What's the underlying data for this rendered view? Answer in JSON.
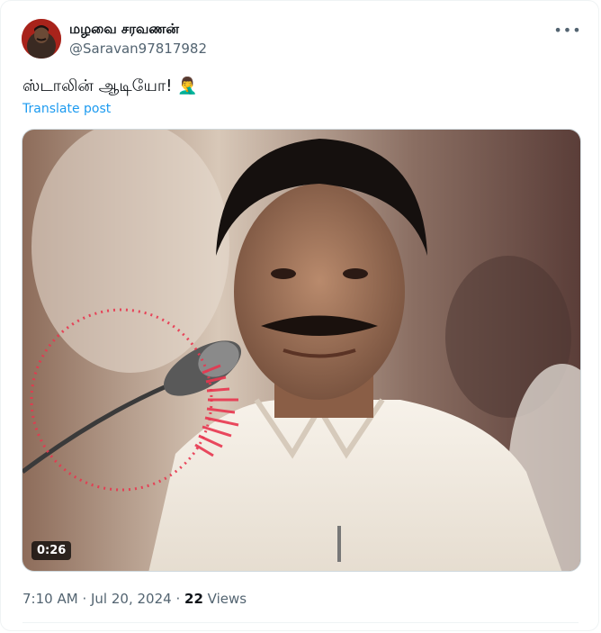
{
  "author": {
    "display_name": "மழவை சரவணன்",
    "handle": "@Saravan97817982"
  },
  "tweet": {
    "text": "ஸ்டாலின் ஆடியோ!",
    "emoji": "🤦‍♂️",
    "translate_label": "Translate post"
  },
  "media": {
    "type": "video",
    "duration": "0:26"
  },
  "meta": {
    "time": "7:10 AM",
    "separator": "·",
    "date": "Jul 20, 2024",
    "views_count": "22",
    "views_label": "Views"
  },
  "icons": {
    "more": "more-horizontal-icon"
  },
  "colors": {
    "link": "#1d9bf0",
    "secondary_text": "#536471",
    "audio_ring": "#e8364f"
  }
}
